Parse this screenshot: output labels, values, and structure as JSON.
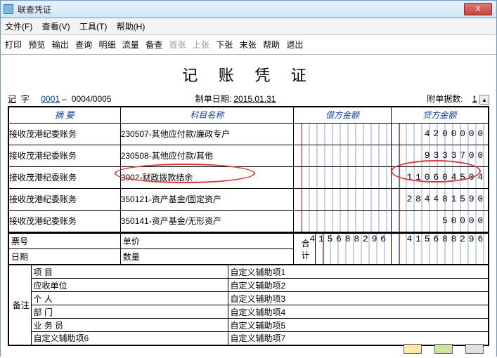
{
  "window": {
    "title": "联查凭证",
    "close": "X"
  },
  "menu": {
    "file": "文件(F)",
    "view": "查看(V)",
    "tool": "工具(T)",
    "help": "帮助(H)"
  },
  "toolbar": {
    "print": "打印",
    "preview": "预览",
    "output": "输出",
    "query": "查询",
    "detail": "明细",
    "flow": "流量",
    "note": "备查",
    "first": "首张",
    "prev": "上张",
    "next": "下张",
    "last": "末张",
    "helpbtn": "帮助",
    "exit": "退出"
  },
  "doc": {
    "title": "记 账 凭 证",
    "ji": "记",
    "zi": "字",
    "seq1": "0001",
    "sep": "–",
    "seq2": "0004/0005",
    "date_label": "制单日期:",
    "date": "2015.01.31",
    "attach_label": "附单据数:",
    "attach": "1"
  },
  "headers": {
    "summary": "摘 要",
    "subject": "科目名称",
    "debit": "借方金额",
    "credit": "贷方金额"
  },
  "rows": [
    {
      "summary": "接收茂港纪委账务",
      "subject": "230507-其他应付款/廉政专户",
      "debit": "",
      "credit": "4200000"
    },
    {
      "summary": "接收茂港纪委账务",
      "subject": "230508-其他应付款/其他",
      "debit": "",
      "credit": "9333700"
    },
    {
      "summary": "接收茂港纪委账务",
      "subject": "3002-财政拨款结余",
      "debit": "",
      "credit": "110604504"
    },
    {
      "summary": "接收茂港纪委账务",
      "subject": "350121-资产基金/固定资产",
      "debit": "",
      "credit": "284481590"
    },
    {
      "summary": "接收茂港纪委账务",
      "subject": "350141-资产基金/无形资产",
      "debit": "",
      "credit": "50000"
    }
  ],
  "sub": {
    "ticket": "票号",
    "price": "单价",
    "date": "日期",
    "qty": "数量",
    "total": "合  计",
    "debit_total": "415688296",
    "credit_total": "415688296"
  },
  "foot": {
    "remark": "备注",
    "left": [
      "项   目",
      "应收单位",
      "个   人",
      "部   门",
      "业 务 员",
      "自定义辅助项6"
    ],
    "right": [
      "自定义辅助项1",
      "自定义辅助项2",
      "自定义辅助项3",
      "自定义辅助项4",
      "自定义辅助项5",
      "自定义辅助项7"
    ]
  }
}
